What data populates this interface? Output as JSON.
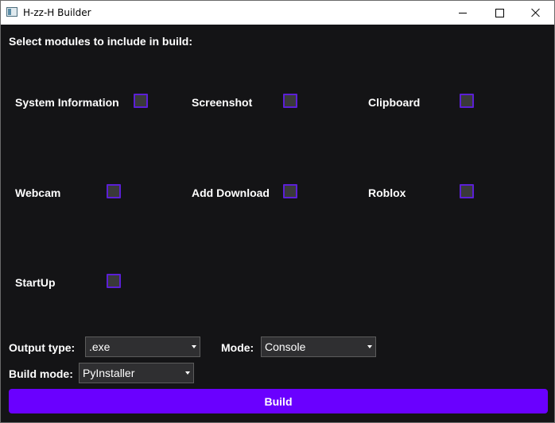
{
  "window": {
    "title": "H-zz-H Builder"
  },
  "heading": "Select modules to include in build:",
  "modules": [
    {
      "label": "System Information",
      "checked": false
    },
    {
      "label": "Screenshot",
      "checked": false
    },
    {
      "label": "Clipboard",
      "checked": false
    },
    {
      "label": "Webcam",
      "checked": false
    },
    {
      "label": "Add Download",
      "checked": false
    },
    {
      "label": "Roblox",
      "checked": false
    },
    {
      "label": "StartUp",
      "checked": false
    }
  ],
  "output_type": {
    "label": "Output type:",
    "value": ".exe"
  },
  "mode": {
    "label": "Mode:",
    "value": "Console"
  },
  "build_mode": {
    "label": "Build mode:",
    "value": "PyInstaller"
  },
  "build_button": {
    "label": "Build"
  },
  "colors": {
    "background": "#141416",
    "accent": "#6a00ff",
    "checkbox_border": "#5b1fd6"
  }
}
